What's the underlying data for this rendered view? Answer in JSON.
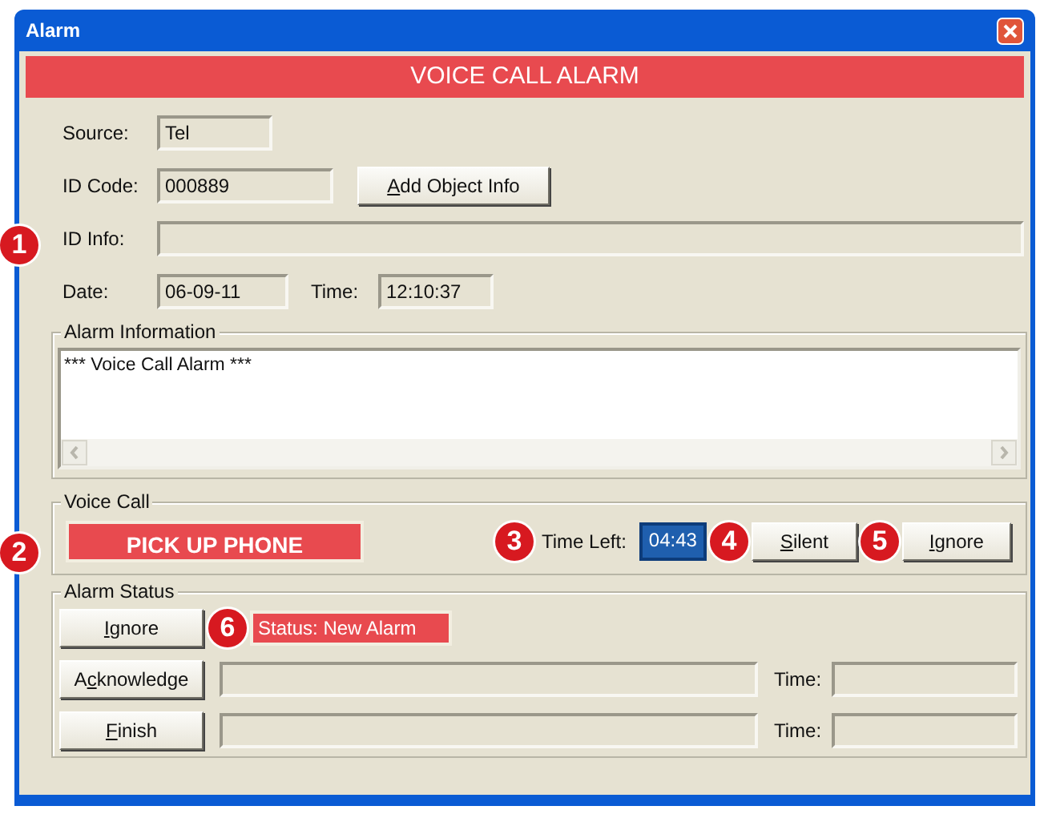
{
  "window": {
    "title": "Alarm"
  },
  "header": "VOICE CALL ALARM",
  "details": {
    "source_label": "Source:",
    "source": "Tel",
    "id_code_label": "ID Code:",
    "id_code": "000889",
    "add_button": {
      "access_key": "A",
      "label_end": "dd Object Info"
    },
    "id_info_label": "ID Info:",
    "date_label": "Date:",
    "date": "06-09-11",
    "time_label": "Time:",
    "time": "12:10:37"
  },
  "alarm_information": {
    "title": "Alarm Information",
    "text": "*** Voice Call Alarm ***"
  },
  "voice_call": {
    "title": "Voice Call",
    "prompt": "PICK UP PHONE",
    "time_left_label": "Time Left:",
    "time_left": "04:43",
    "buttons": [
      {
        "access_key": "S",
        "label_end": "ilent"
      },
      {
        "access_key": "I",
        "label_end": "gnore"
      }
    ]
  },
  "alarm_status": {
    "title": "Alarm Status",
    "ignore_button": {
      "access_key": "I",
      "label_end": "gnore"
    },
    "status": "Status: New Alarm",
    "rows": [
      {
        "label_start": "A",
        "access_key": "c",
        "label_end": "knowledge",
        "time_label": "Time:"
      },
      {
        "access_key": "F",
        "label_end": "inish",
        "time_label": "Time:"
      }
    ]
  },
  "callouts": [
    "1",
    "2",
    "3",
    "4",
    "5",
    "6"
  ]
}
